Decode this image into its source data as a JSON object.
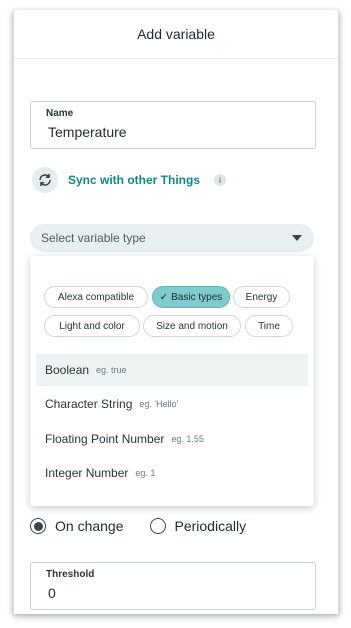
{
  "dialog": {
    "title": "Add variable"
  },
  "name_field": {
    "label": "Name",
    "value": "Temperature"
  },
  "sync": {
    "label": "Sync with other Things",
    "info_icon": "i"
  },
  "variable_type": {
    "placeholder": "Select variable type"
  },
  "filter_chips": [
    {
      "label": "Alexa compatible",
      "selected": false
    },
    {
      "label": "Basic types",
      "selected": true
    },
    {
      "label": "Energy",
      "selected": false
    },
    {
      "label": "Light and color",
      "selected": false
    },
    {
      "label": "Size and motion",
      "selected": false
    },
    {
      "label": "Time",
      "selected": false
    }
  ],
  "type_options": [
    {
      "name": "Boolean",
      "example": "eg. true"
    },
    {
      "name": "Character String",
      "example": "eg. 'Hello'"
    },
    {
      "name": "Floating Point Number",
      "example": "eg. 1.55"
    },
    {
      "name": "Integer Number",
      "example": "eg. 1"
    }
  ],
  "update_policy": {
    "options": [
      {
        "label": "On change",
        "selected": true
      },
      {
        "label": "Periodically",
        "selected": false
      }
    ]
  },
  "threshold_field": {
    "label": "Threshold",
    "value": "0"
  },
  "side_info_icon": "i",
  "colors": {
    "accent": "#12868c",
    "chip_active": "#7fcbcd"
  }
}
